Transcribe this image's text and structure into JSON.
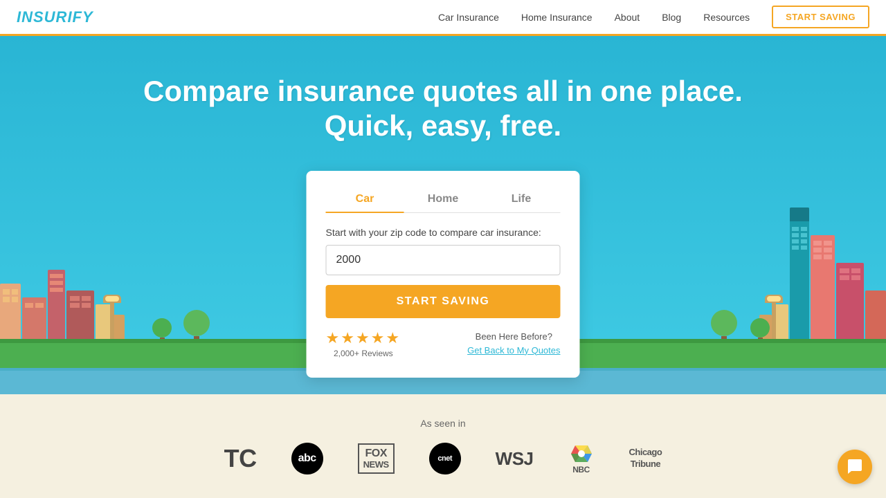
{
  "header": {
    "logo": "INSURIFY",
    "nav": {
      "car_insurance": "Car Insurance",
      "home_insurance": "Home Insurance",
      "about": "About",
      "blog": "Blog",
      "resources": "Resources",
      "start_saving": "START SAVING"
    }
  },
  "hero": {
    "headline_line1": "Compare insurance quotes all in one place.",
    "headline_line2": "Quick, easy, free.",
    "bg_color": "#2db8d6"
  },
  "quote_card": {
    "tabs": [
      {
        "id": "car",
        "label": "Car",
        "active": true
      },
      {
        "id": "home",
        "label": "Home",
        "active": false
      },
      {
        "id": "life",
        "label": "Life",
        "active": false
      }
    ],
    "zip_label": "Start with your zip code to compare car insurance:",
    "zip_placeholder": "",
    "zip_value": "2000",
    "start_button": "START SAVING",
    "stars": "★★★★★",
    "reviews_count": "2,000+ Reviews",
    "been_here": "Been Here Before?",
    "get_back_link": "Get Back to My Quotes"
  },
  "as_seen_in": {
    "label": "As seen in",
    "logos": [
      {
        "name": "TechCrunch",
        "display": "TC"
      },
      {
        "name": "ABC",
        "display": "abc"
      },
      {
        "name": "Fox News",
        "display": "FOX\nNEWS"
      },
      {
        "name": "CNET",
        "display": "cnet"
      },
      {
        "name": "WSJ",
        "display": "WSJ"
      },
      {
        "name": "NBC",
        "display": "NBC"
      },
      {
        "name": "Chicago Tribune",
        "display": "Chicago\nTribune"
      }
    ]
  },
  "chat": {
    "icon": "💬"
  }
}
